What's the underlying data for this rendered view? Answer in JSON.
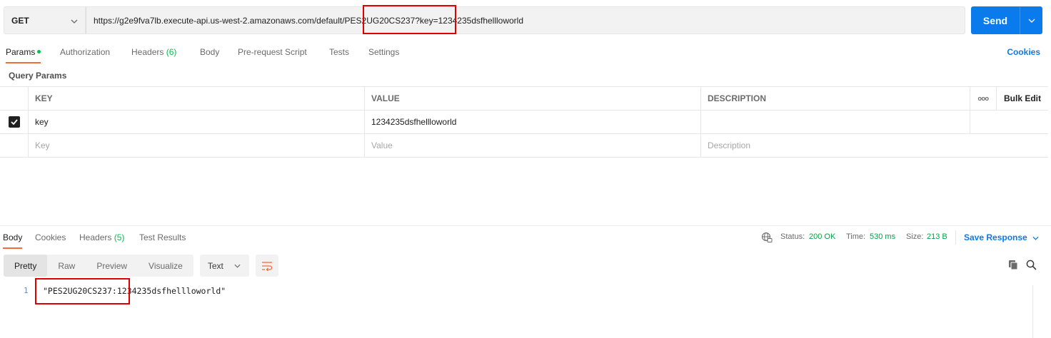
{
  "request": {
    "method": "GET",
    "url": "https://g2e9fva7lb.execute-api.us-west-2.amazonaws.com/default/PES2UG20CS237?key=1234235dsfhellloworld",
    "send_label": "Send"
  },
  "tabs": {
    "params": "Params",
    "authorization": "Authorization",
    "headers": "Headers",
    "headers_count": "(6)",
    "body": "Body",
    "prerequest": "Pre-request Script",
    "tests": "Tests",
    "settings": "Settings",
    "cookies": "Cookies"
  },
  "query_params": {
    "title": "Query Params",
    "columns": {
      "key": "KEY",
      "value": "VALUE",
      "description": "DESCRIPTION",
      "more": "ooo",
      "bulk_edit": "Bulk Edit"
    },
    "rows": [
      {
        "checked": true,
        "key": "key",
        "value": "1234235dsfhellloworld",
        "description": ""
      }
    ],
    "placeholders": {
      "key": "Key",
      "value": "Value",
      "description": "Description"
    }
  },
  "response": {
    "tabs": {
      "body": "Body",
      "cookies": "Cookies",
      "headers": "Headers",
      "headers_count": "(5)",
      "test_results": "Test Results"
    },
    "status_label": "Status:",
    "status_value": "200 OK",
    "time_label": "Time:",
    "time_value": "530 ms",
    "size_label": "Size:",
    "size_value": "213 B",
    "save_label": "Save Response",
    "view_modes": {
      "pretty": "Pretty",
      "raw": "Raw",
      "preview": "Preview",
      "visualize": "Visualize"
    },
    "format": "Text",
    "lines": [
      {
        "num": "1",
        "text": "\"PES2UG20CS237:1234235dsfhellloworld\""
      }
    ]
  },
  "colors": {
    "accent": "#097bed",
    "active_tab": "#f26b3a",
    "success": "#0cbb52",
    "highlight_box": "#e00000"
  }
}
